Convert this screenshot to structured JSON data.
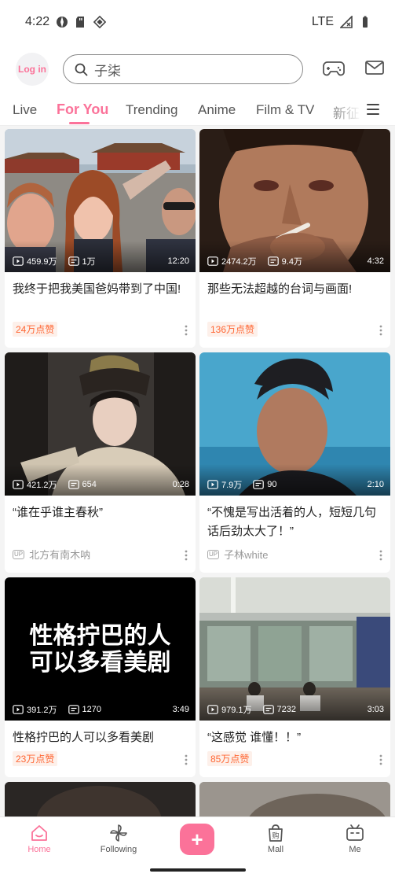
{
  "status_bar": {
    "time": "4:22",
    "network": "LTE"
  },
  "header": {
    "login_label": "Log in",
    "search_placeholder": "子柒"
  },
  "tabs": [
    "Live",
    "For You",
    "Trending",
    "Anime",
    "Film & TV",
    "新征"
  ],
  "active_tab": "For You",
  "videos": [
    {
      "views": "459.9万",
      "danmaku": "1万",
      "duration": "12:20",
      "title": "我终于把我美国爸妈带到了中国!",
      "likes": "24万点赞",
      "uploader": ""
    },
    {
      "views": "2474.2万",
      "danmaku": "9.4万",
      "duration": "4:32",
      "title": "那些无法超越的台词与画面!",
      "likes": "136万点赞",
      "uploader": ""
    },
    {
      "views": "421.2万",
      "danmaku": "654",
      "duration": "0:28",
      "title": "“谁在乎谁主春秋”",
      "likes": "",
      "uploader": "北方有南木呐"
    },
    {
      "views": "7.9万",
      "danmaku": "90",
      "duration": "2:10",
      "title": "“不愧是写出活着的人，短短几句话后劲太大了！”",
      "likes": "",
      "uploader": "子林white"
    },
    {
      "views": "391.2万",
      "danmaku": "1270",
      "duration": "3:49",
      "title": "性格拧巴的人可以多看美剧",
      "likes": "23万点赞",
      "uploader": "",
      "thumb_text": [
        "性格拧巴的人",
        "可以多看美剧"
      ]
    },
    {
      "views": "979.1万",
      "danmaku": "7232",
      "duration": "3:03",
      "title": "“这感觉 谁懂！！”",
      "likes": "85万点赞",
      "uploader": ""
    }
  ],
  "bottom_nav": {
    "home": "Home",
    "following": "Following",
    "mall": "Mall",
    "me": "Me",
    "mall_icon_text": "购"
  },
  "colors": {
    "accent": "#fb7299",
    "likes_text": "#ff6633",
    "likes_bg": "#fdf0ea"
  }
}
